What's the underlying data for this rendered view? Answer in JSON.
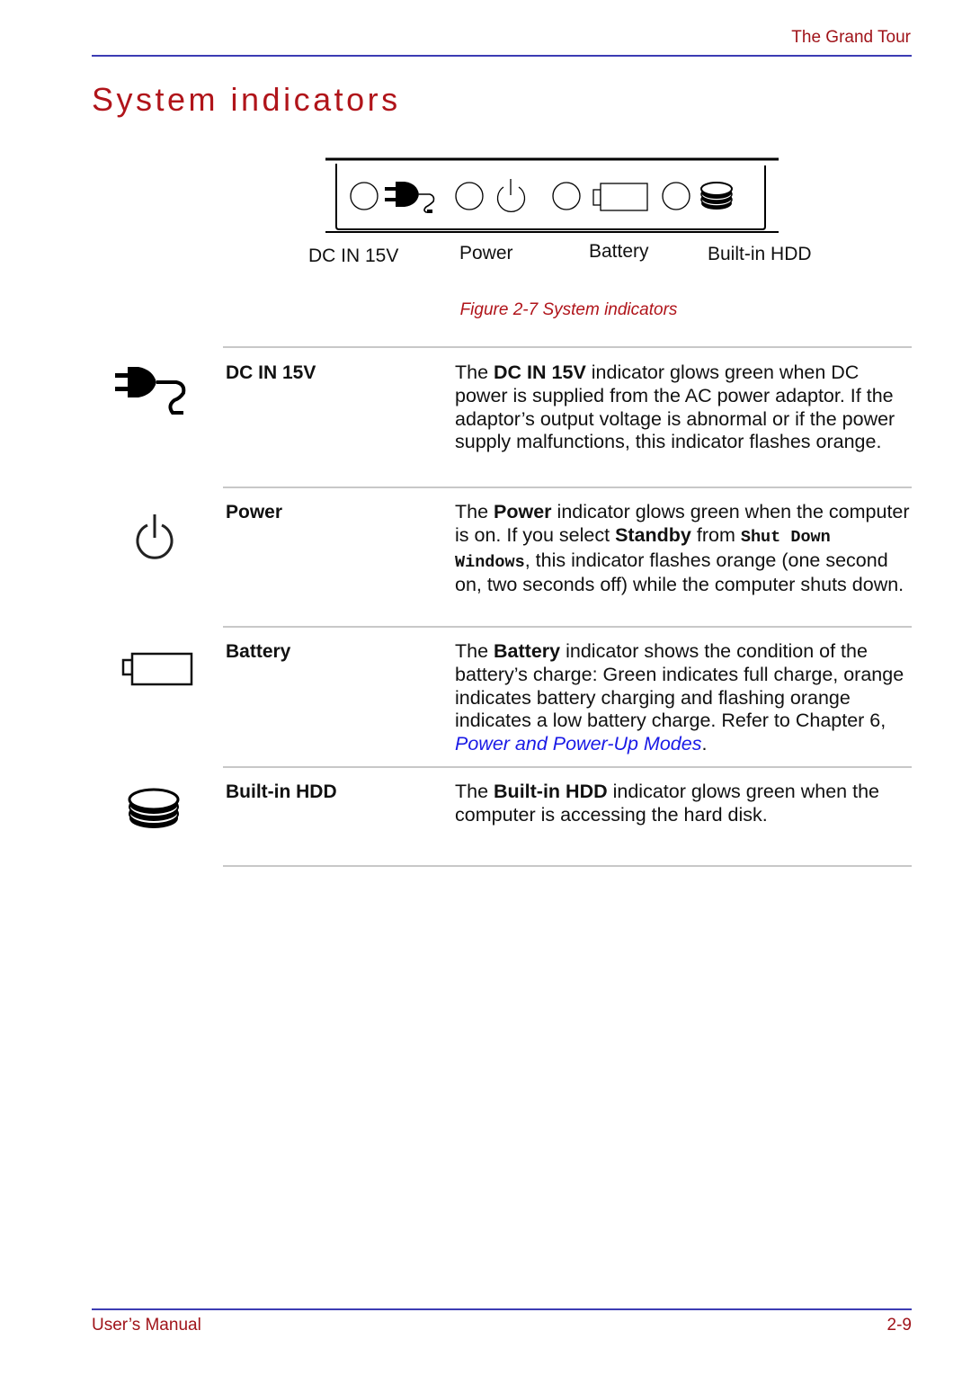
{
  "header": {
    "section": "The Grand Tour"
  },
  "page_title": "System indicators",
  "figure": {
    "labels": [
      "DC IN 15V",
      "Power",
      "Battery",
      "Built-in HDD"
    ],
    "icons": [
      "plug-icon",
      "power-icon",
      "battery-icon",
      "hdd-icon"
    ],
    "caption": "Figure 2-7 System indicators"
  },
  "indicators": [
    {
      "term": "DC IN 15V",
      "icon": "plug-icon",
      "desc": [
        {
          "t": "The "
        },
        {
          "b": "DC IN 15V"
        },
        {
          "t": " indicator glows green when DC power is supplied from the AC power adaptor. If the adaptor’s output voltage is abnormal or if the power supply malfunctions, this indicator flashes orange."
        }
      ]
    },
    {
      "term": "Power",
      "icon": "power-icon",
      "desc": [
        {
          "t": "The "
        },
        {
          "b": "Power"
        },
        {
          "t": " indicator glows green when the computer is on. If you select "
        },
        {
          "b": "Standby"
        },
        {
          "t": " from "
        },
        {
          "m": "Shut Down Windows"
        },
        {
          "t": ", this indicator flashes orange (one second on, two seconds off) while the computer shuts down."
        }
      ]
    },
    {
      "term": "Battery",
      "icon": "battery-icon",
      "desc": [
        {
          "t": "The "
        },
        {
          "b": "Battery"
        },
        {
          "t": " indicator shows the condition of the battery’s charge: Green indicates full charge, orange indicates battery charging and flashing orange indicates a low battery charge. Refer to Chapter 6, "
        },
        {
          "l": "Power and Power-Up Modes"
        },
        {
          "t": "."
        }
      ]
    },
    {
      "term": "Built-in HDD",
      "icon": "hdd-icon",
      "desc": [
        {
          "t": "The "
        },
        {
          "b": "Built-in HDD"
        },
        {
          "t": " indicator glows green when the computer is accessing the hard disk."
        }
      ]
    }
  ],
  "footer": {
    "left": "User’s Manual",
    "right": "2-9"
  },
  "colors": {
    "heading": "#b0141a",
    "rule": "#3c3cb4",
    "link": "#1a1ae6"
  }
}
